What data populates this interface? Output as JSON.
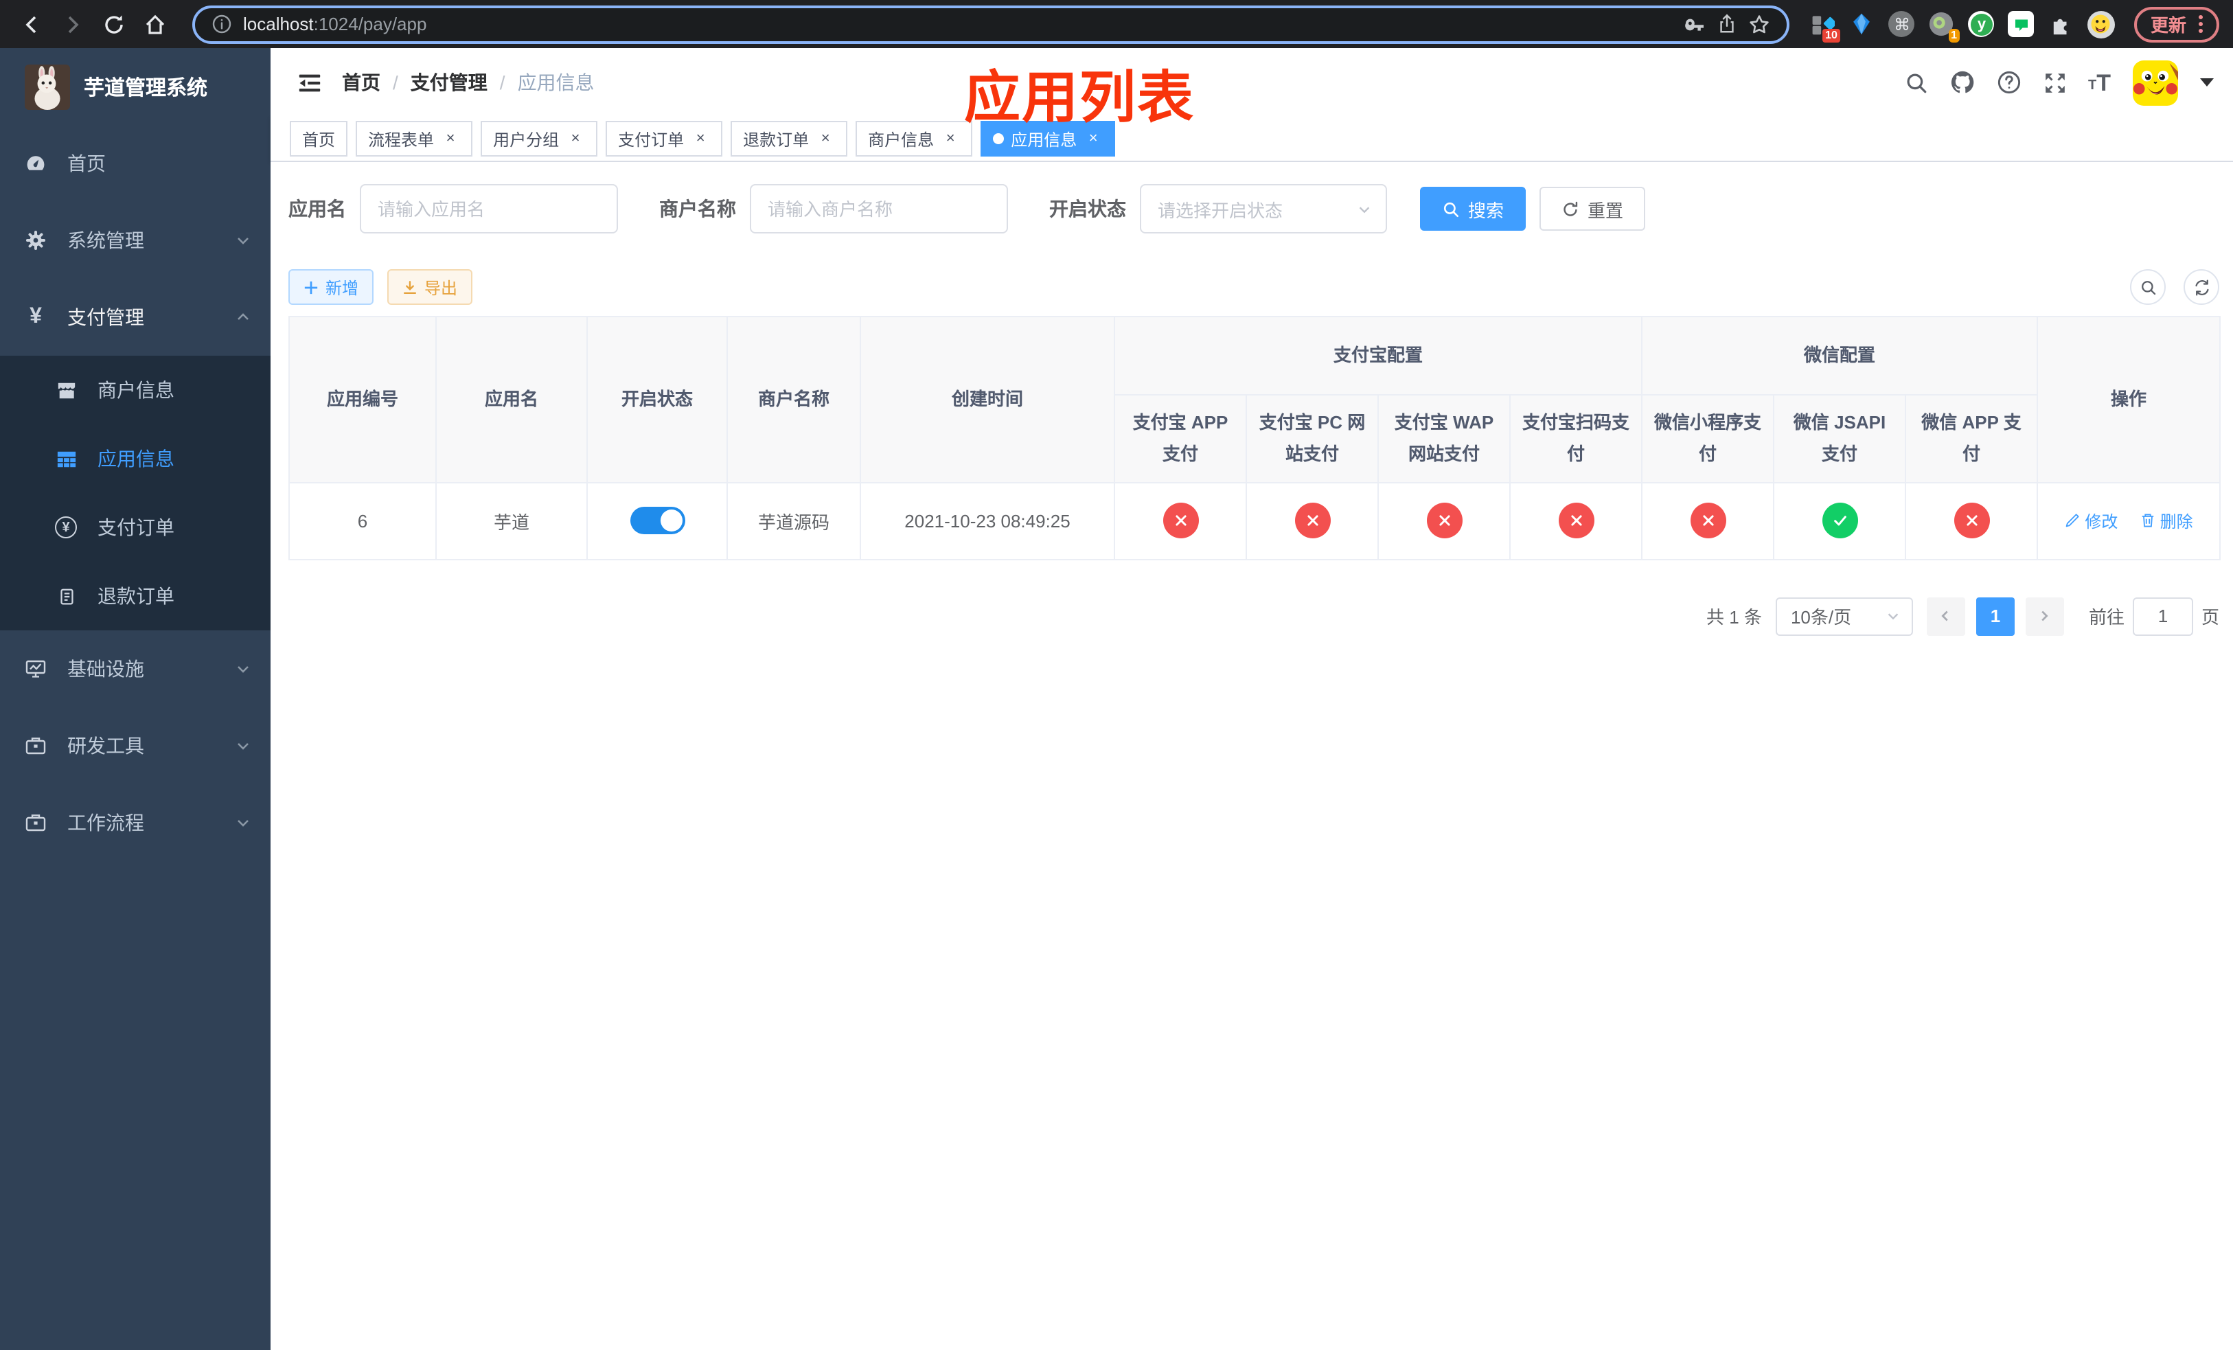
{
  "browser": {
    "url_host": "localhost",
    "url_rest": ":1024/pay/app",
    "ext_badge_blocks": "10",
    "ext_badge_target": "1",
    "ext_letter": "y",
    "update_label": "更新"
  },
  "sidebar": {
    "title": "芋道管理系统",
    "menu_home": "首页",
    "menu_system": "系统管理",
    "menu_payment": "支付管理",
    "sub_merchant": "商户信息",
    "sub_app": "应用信息",
    "sub_pay_order": "支付订单",
    "sub_refund_order": "退款订单",
    "menu_infra": "基础设施",
    "menu_devtools": "研发工具",
    "menu_workflow": "工作流程"
  },
  "navbar": {
    "breadcrumb": [
      "首页",
      "支付管理",
      "应用信息"
    ]
  },
  "annotation": {
    "title": "应用列表",
    "color": "#f8340b"
  },
  "tags": {
    "items": [
      {
        "label": "首页",
        "closable": false,
        "active": false
      },
      {
        "label": "流程表单",
        "closable": true,
        "active": false
      },
      {
        "label": "用户分组",
        "closable": true,
        "active": false
      },
      {
        "label": "支付订单",
        "closable": true,
        "active": false
      },
      {
        "label": "退款订单",
        "closable": true,
        "active": false
      },
      {
        "label": "商户信息",
        "closable": true,
        "active": false
      },
      {
        "label": "应用信息",
        "closable": true,
        "active": true
      }
    ]
  },
  "search_form": {
    "app_name_label": "应用名",
    "app_name_placeholder": "请输入应用名",
    "merchant_label": "商户名称",
    "merchant_placeholder": "请输入商户名称",
    "status_label": "开启状态",
    "status_placeholder": "请选择开启状态",
    "search_button": "搜索",
    "reset_button": "重置"
  },
  "toolbar": {
    "add_label": "新增",
    "export_label": "导出"
  },
  "table": {
    "headers": {
      "app_id": "应用编号",
      "app_name": "应用名",
      "status": "开启状态",
      "merchant_name": "商户名称",
      "create_time": "创建时间",
      "alipay_group": "支付宝配置",
      "wechat_group": "微信配置",
      "actions": "操作",
      "alipay_cols": [
        "支付宝 APP 支付",
        "支付宝 PC 网站支付",
        "支付宝 WAP 网站支付",
        "支付宝扫码支付"
      ],
      "wechat_cols": [
        "微信小程序支付",
        "微信 JSAPI 支付",
        "微信 APP 支付"
      ]
    },
    "row": {
      "app_id": "6",
      "app_name": "芋道",
      "status_on": true,
      "merchant_name": "芋道源码",
      "create_time": "2021-10-23 08:49:25",
      "channel_statuses": [
        "disabled",
        "disabled",
        "disabled",
        "disabled",
        "disabled",
        "enabled",
        "disabled"
      ],
      "edit_label": "修改",
      "delete_label": "删除"
    }
  },
  "pagination": {
    "total_text": "共 1 条",
    "page_size": "10条/页",
    "current_page": "1",
    "goto_prefix": "前往",
    "goto_value": "1",
    "goto_suffix": "页"
  },
  "colors": {
    "primary": "#409eff",
    "sidebar_bg": "#304156",
    "submenu_bg": "#1f2d3d",
    "danger_circle": "#f3504f",
    "success_circle": "#12ce66",
    "annotation_red": "#f8340b"
  }
}
